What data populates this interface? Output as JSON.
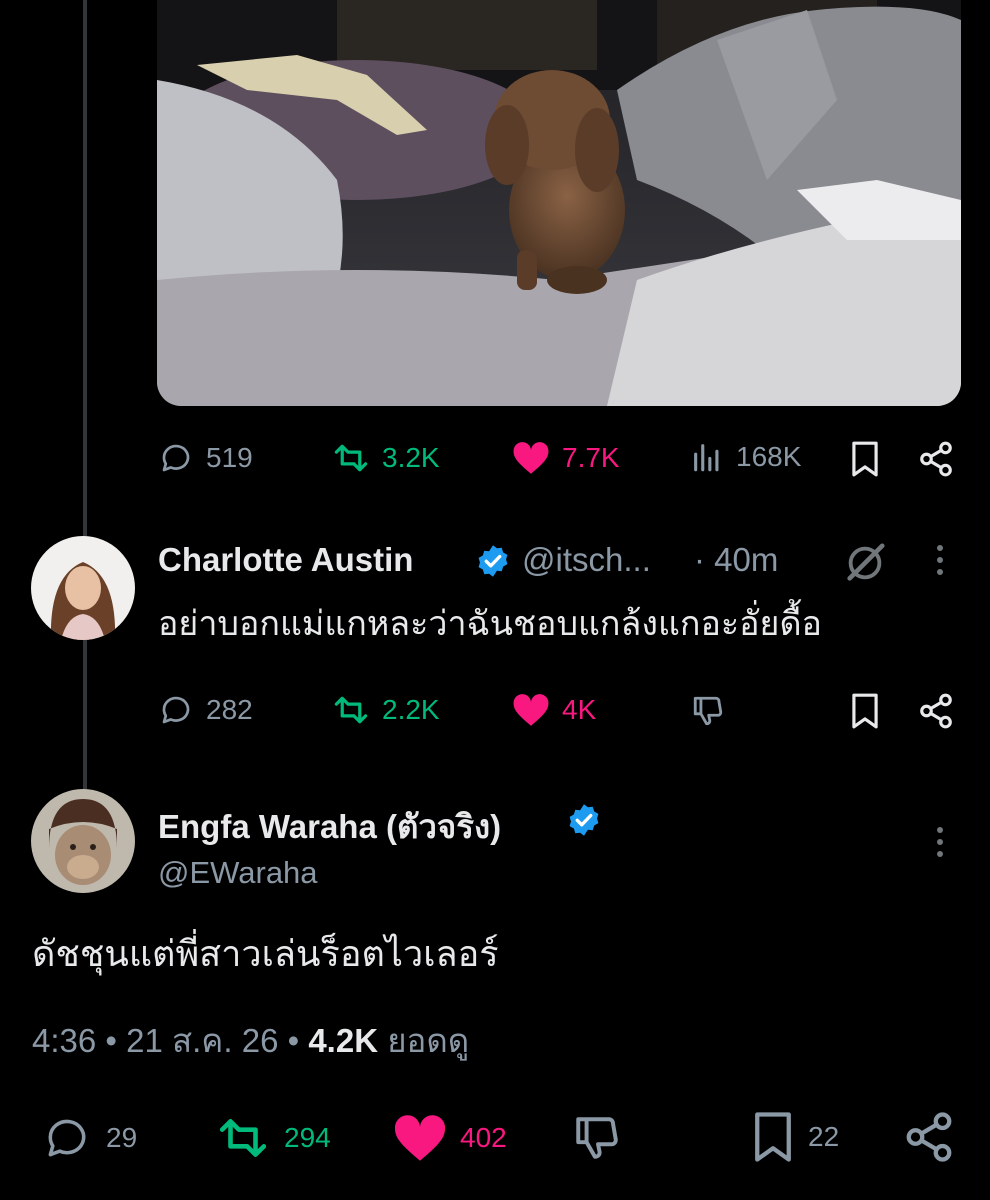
{
  "top_tweet": {
    "stats": {
      "replies": "519",
      "retweets": "3.2K",
      "likes": "7.7K",
      "views": "168K"
    }
  },
  "reply1": {
    "name": "Charlotte Austin",
    "handle": "@itsch...",
    "time": "· 40m",
    "text": "อย่าบอกแม่แกหละว่าฉันชอบแกล้งแกอะอั่ยดื้อ",
    "stats": {
      "replies": "282",
      "retweets": "2.2K",
      "likes": "4K"
    }
  },
  "reply2": {
    "name": "Engfa Waraha (ตัวจริง)",
    "handle": "@EWaraha",
    "text": "ดัชชุนแต่พี่สาวเล่นร็อตไวเลอร์",
    "meta": {
      "time": "4:36",
      "date": "21 ส.ค. 26",
      "views": "4.2K",
      "views_label": "ยอดดู"
    },
    "stats": {
      "replies": "29",
      "retweets": "294",
      "likes": "402",
      "bookmarks": "22"
    }
  },
  "colors": {
    "background": "#000000",
    "muted": "#8b98a5",
    "green": "#00ba7c",
    "pink": "#f91880",
    "verified": "#1d9bf0"
  }
}
